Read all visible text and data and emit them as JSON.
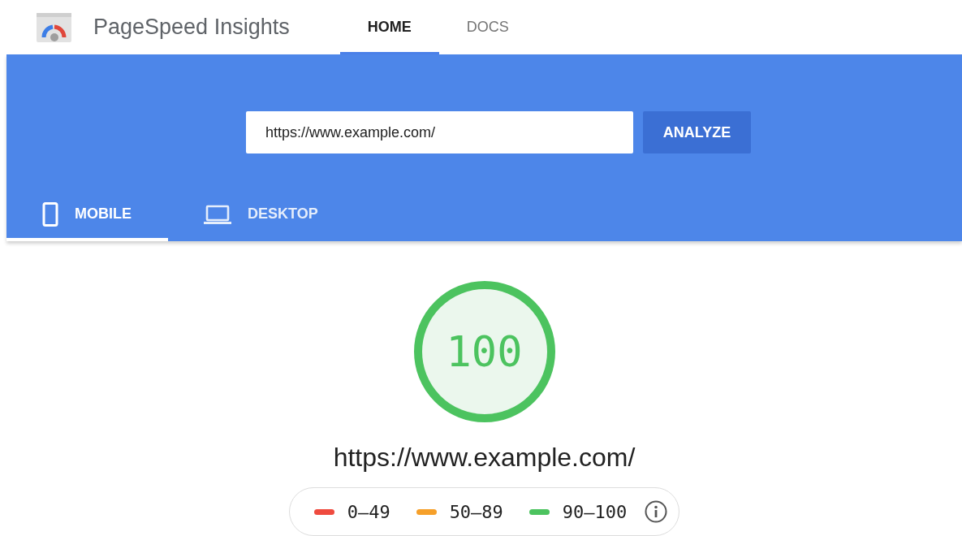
{
  "header": {
    "title": "PageSpeed Insights",
    "nav": [
      {
        "label": "HOME",
        "selected": true
      },
      {
        "label": "DOCS",
        "selected": false
      }
    ]
  },
  "search": {
    "value": "https://www.example.com/",
    "button": "ANALYZE"
  },
  "device_tabs": [
    {
      "label": "MOBILE",
      "kind": "phone",
      "selected": true
    },
    {
      "label": "DESKTOP",
      "kind": "laptop",
      "selected": false
    }
  ],
  "score": {
    "value": "100",
    "level": 1,
    "color": "#4cc35f"
  },
  "url": "https://www.example.com/",
  "legend": [
    {
      "label": "0–49",
      "color": "#ef4b3f"
    },
    {
      "label": "50–89",
      "color": "#f6a02a"
    },
    {
      "label": "90–100",
      "color": "#4cc35f"
    }
  ]
}
